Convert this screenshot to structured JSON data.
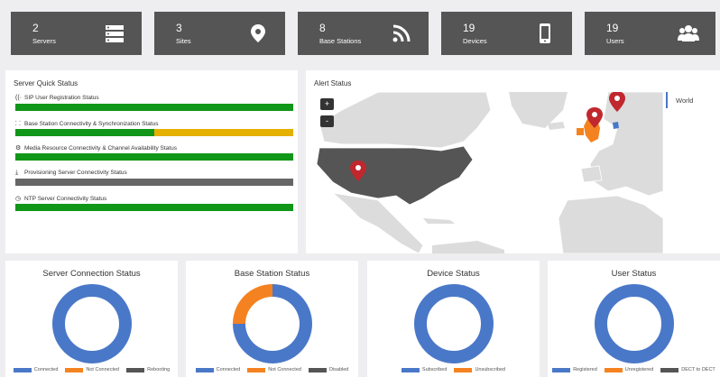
{
  "tiles": [
    {
      "count": "2",
      "label": "Servers",
      "icon": "server-icon"
    },
    {
      "count": "3",
      "label": "Sites",
      "icon": "location-pin-icon"
    },
    {
      "count": "8",
      "label": "Base Stations",
      "icon": "rss-icon"
    },
    {
      "count": "19",
      "label": "Devices",
      "icon": "mobile-icon"
    },
    {
      "count": "19",
      "label": "Users",
      "icon": "users-icon"
    }
  ],
  "quick_status": {
    "title": "Server Quick Status",
    "rows": [
      {
        "label": "SIP User Registration Status",
        "icon": "signal-icon",
        "green": 1.0,
        "yellow": 0.0,
        "gray": 0.0
      },
      {
        "label": "Base Station Connectivity & Synchronization Status",
        "icon": "rss-icon",
        "green": 0.5,
        "yellow": 0.5,
        "gray": 0.0
      },
      {
        "label": "Media Resource Connectivity & Channel Availability Status",
        "icon": "cogs-icon",
        "green": 1.0,
        "yellow": 0.0,
        "gray": 0.0
      },
      {
        "label": "Provisioning Server Connectivity Status",
        "icon": "download-icon",
        "green": 0.0,
        "yellow": 0.0,
        "gray": 1.0
      },
      {
        "label": "NTP Server Connectivity Status",
        "icon": "clock-icon",
        "green": 1.0,
        "yellow": 0.0,
        "gray": 0.0
      }
    ]
  },
  "alert_status": {
    "title": "Alert Status",
    "zoom_in": "+",
    "zoom_out": "-",
    "region_tab": "World"
  },
  "colors": {
    "green": "#109618",
    "yellow": "#e6b000",
    "gray": "#666666",
    "blue": "#4a78c8",
    "orange": "#f58220",
    "dark": "#555555"
  },
  "donuts": [
    {
      "title": "Server Connection Status",
      "segments": [
        1,
        0,
        0
      ],
      "legend": [
        {
          "label": "Connected",
          "color": "#4a78c8"
        },
        {
          "label": "Not Connected",
          "color": "#f58220"
        },
        {
          "label": "Rebooting",
          "color": "#555555"
        }
      ]
    },
    {
      "title": "Base Station Status",
      "segments": [
        0.75,
        0.25,
        0
      ],
      "legend": [
        {
          "label": "Connected",
          "color": "#4a78c8"
        },
        {
          "label": "Not Connected",
          "color": "#f58220"
        },
        {
          "label": "Disabled",
          "color": "#555555"
        }
      ]
    },
    {
      "title": "Device Status",
      "segments": [
        1,
        0
      ],
      "legend": [
        {
          "label": "Subscribed",
          "color": "#4a78c8"
        },
        {
          "label": "Unsubscribed",
          "color": "#f58220"
        }
      ]
    },
    {
      "title": "User Status",
      "segments": [
        1,
        0,
        0
      ],
      "legend": [
        {
          "label": "Registered",
          "color": "#4a78c8"
        },
        {
          "label": "Unregistered",
          "color": "#f58220"
        },
        {
          "label": "DECT to DECT",
          "color": "#555555"
        }
      ]
    }
  ]
}
